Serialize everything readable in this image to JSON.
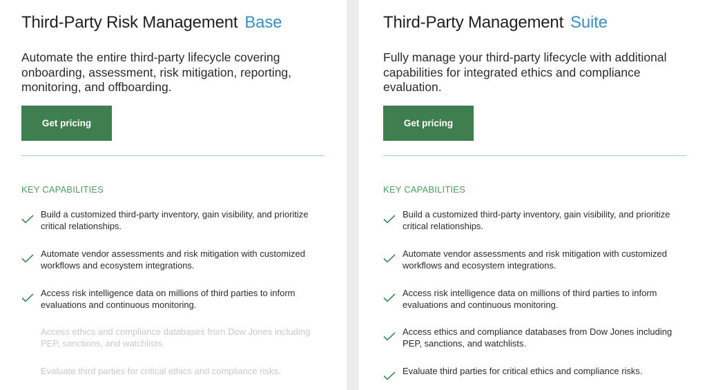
{
  "plans": [
    {
      "title": "Third-Party Risk Management",
      "tier": "Base",
      "description": "Automate the entire third-party lifecycle covering onboarding, assessment, risk mitigation, reporting, monitoring, and offboarding.",
      "button_label": "Get pricing",
      "capabilities_heading": "KEY CAPABILITIES",
      "capabilities": [
        {
          "text": "Build a customized third-party inventory, gain visibility, and prioritize critical relationships.",
          "included": true
        },
        {
          "text": "Automate vendor assessments and risk mitigation with customized workflows and ecosystem integrations.",
          "included": true
        },
        {
          "text": "Access risk intelligence data on millions of third parties to inform evaluations and continuous monitoring.",
          "included": true
        },
        {
          "text": "Access ethics and compliance databases from Dow Jones including PEP, sanctions, and watchlists.",
          "included": false
        },
        {
          "text": "Evaluate third parties for critical ethics and compliance risks.",
          "included": false
        }
      ]
    },
    {
      "title": "Third-Party Management",
      "tier": "Suite",
      "description": "Fully manage your third-party lifecycle with additional capabilities for integrated ethics and compliance evaluation.",
      "button_label": "Get pricing",
      "capabilities_heading": "KEY CAPABILITIES",
      "capabilities": [
        {
          "text": "Build a customized third-party inventory, gain visibility, and prioritize critical relationships.",
          "included": true
        },
        {
          "text": "Automate vendor assessments and risk mitigation with customized workflows and ecosystem integrations.",
          "included": true
        },
        {
          "text": "Access risk intelligence data on millions of third parties to inform evaluations and continuous monitoring.",
          "included": true
        },
        {
          "text": "Access ethics and compliance databases from Dow Jones including PEP, sanctions, and watchlists.",
          "included": true
        },
        {
          "text": "Evaluate third parties for critical ethics and compliance risks.",
          "included": true
        }
      ]
    }
  ],
  "colors": {
    "button": "#3f7e4f",
    "tier": "#3a8fc0",
    "heading": "#4f9a5e",
    "check": "#3f8a52",
    "divider": "#9fd0a9"
  }
}
